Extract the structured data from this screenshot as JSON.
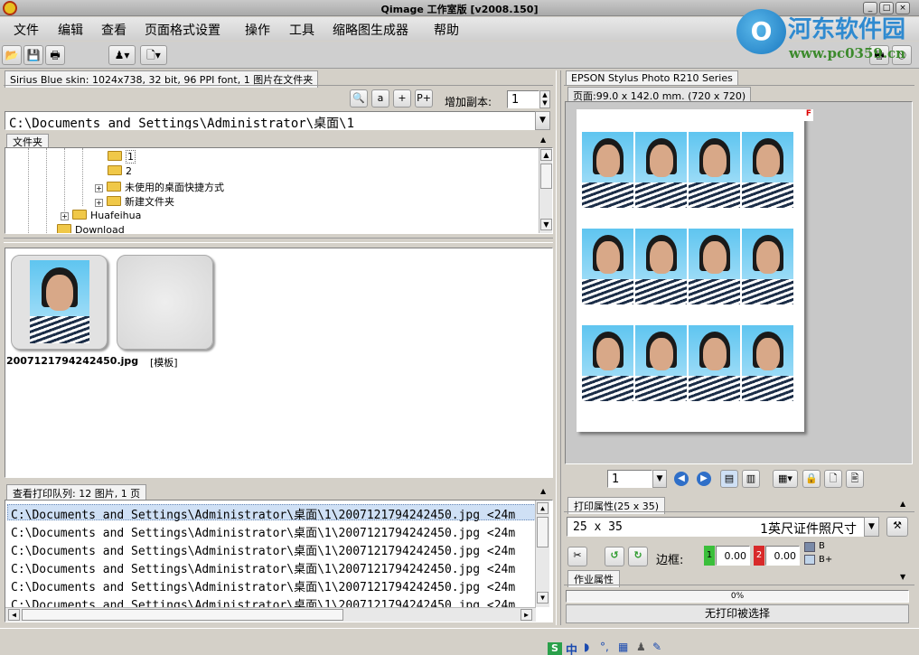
{
  "window": {
    "title": "Qimage 工作室版 [v2008.150]",
    "min": "_",
    "max": "□",
    "close": "×"
  },
  "menu": [
    "文件",
    "编辑",
    "查看",
    "页面格式设置",
    "操作",
    "工具",
    "缩略图生成器",
    "帮助"
  ],
  "watermark": {
    "logo": "O",
    "text": "河东软件园",
    "url": "www.pc0359.cn"
  },
  "left": {
    "status_tab": "Sirius Blue skin: 1024x738, 32 bit, 96 PPI font, 1 图片在文件夹",
    "copies_label": "增加副本:",
    "copies_value": "1",
    "path": "C:\\Documents and Settings\\Administrator\\桌面\\1",
    "folder_tab": "文件夹",
    "tree": [
      {
        "label": "1",
        "indent": 118,
        "plus": false
      },
      {
        "label": "2",
        "indent": 118,
        "plus": false
      },
      {
        "label": "未使用的桌面快捷方式",
        "indent": 104,
        "plus": true
      },
      {
        "label": "新建文件夹",
        "indent": 104,
        "plus": true
      },
      {
        "label": "Huafeihua",
        "indent": 66,
        "plus": true
      },
      {
        "label": "Download",
        "indent": 52,
        "plus": false
      }
    ],
    "thumbs": [
      {
        "label": "2007121794242450.jpg"
      },
      {
        "label": "[模板]"
      }
    ],
    "queue_tab": "查看打印队列: 12 图片, 1 页",
    "queue_rows": [
      "C:\\Documents and Settings\\Administrator\\桌面\\1\\2007121794242450.jpg <24m",
      "C:\\Documents and Settings\\Administrator\\桌面\\1\\2007121794242450.jpg <24m",
      "C:\\Documents and Settings\\Administrator\\桌面\\1\\2007121794242450.jpg <24m",
      "C:\\Documents and Settings\\Administrator\\桌面\\1\\2007121794242450.jpg <24m",
      "C:\\Documents and Settings\\Administrator\\桌面\\1\\2007121794242450.jpg <24m",
      "C:\\Documents and Settings\\Administrator\\桌面\\1\\2007121794242450.jpg <24m"
    ]
  },
  "right": {
    "printer_tab": "EPSON Stylus Photo R210 Series",
    "page_info": "页面:99.0 x 142.0 mm.  (720 x 720)",
    "page_marker": "F",
    "page_select": "1",
    "print_props_tab": "打印属性(25 x 35)",
    "size_left": "25  x  35",
    "size_right": "1英尺证件照尺寸",
    "border_label": "边框:",
    "border_1_tag": "1",
    "border_1_value": "0.00",
    "border_2_tag": "2",
    "border_2_value": "0.00",
    "opt_b": "B",
    "opt_bplus": "B+",
    "job_props_tab": "作业属性",
    "progress": "0%",
    "progress_fraction": 0,
    "status": "无打印被选择"
  },
  "taskbar": {
    "ime": "S",
    "ime_lang": "中"
  }
}
